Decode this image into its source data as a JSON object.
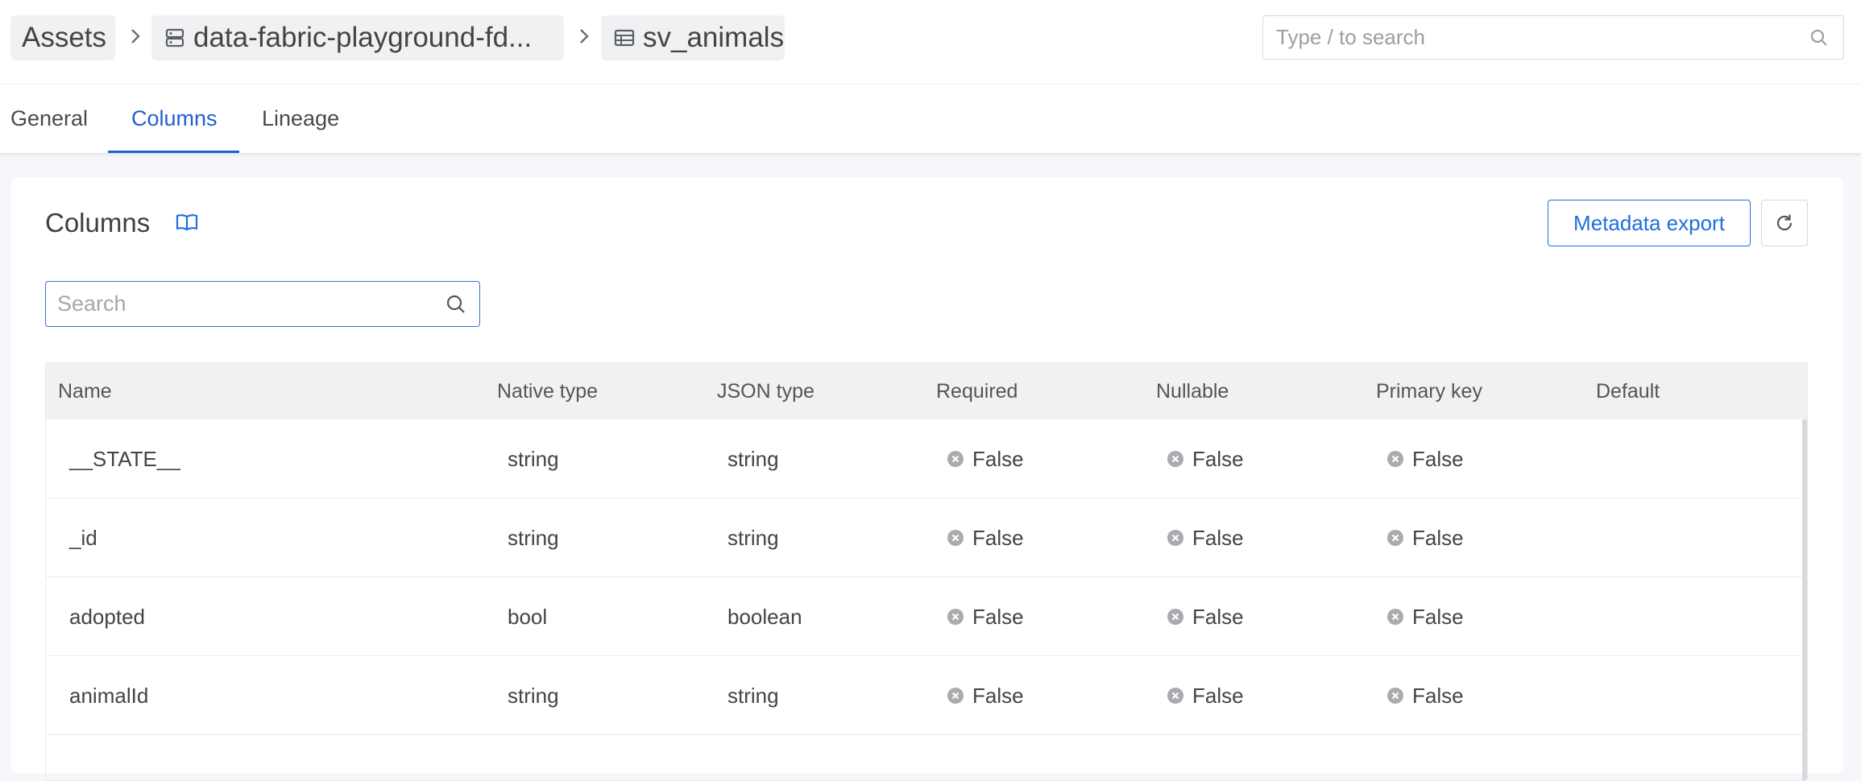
{
  "breadcrumb": {
    "items": [
      {
        "label": "Assets"
      },
      {
        "label": "data-fabric-playground-fd...",
        "icon": "database-icon"
      },
      {
        "label": "sv_animals",
        "icon": "table-icon"
      }
    ]
  },
  "search": {
    "placeholder": "Type / to search"
  },
  "tabs": [
    {
      "label": "General"
    },
    {
      "label": "Columns",
      "active": true
    },
    {
      "label": "Lineage"
    }
  ],
  "columns_panel": {
    "title": "Columns",
    "export_label": "Metadata export",
    "search_placeholder": "Search",
    "headers": [
      "Name",
      "Native type",
      "JSON type",
      "Required",
      "Nullable",
      "Primary key",
      "Default"
    ],
    "rows": [
      {
        "name": "__STATE__",
        "native": "string",
        "json": "string",
        "required": "False",
        "nullable": "False",
        "primary": "False",
        "default": ""
      },
      {
        "name": "_id",
        "native": "string",
        "json": "string",
        "required": "False",
        "nullable": "False",
        "primary": "False",
        "default": ""
      },
      {
        "name": "adopted",
        "native": "bool",
        "json": "boolean",
        "required": "False",
        "nullable": "False",
        "primary": "False",
        "default": ""
      },
      {
        "name": "animalId",
        "native": "string",
        "json": "string",
        "required": "False",
        "nullable": "False",
        "primary": "False",
        "default": ""
      }
    ]
  },
  "colors": {
    "accent": "#1f5fd6",
    "false_icon": "#a9abae"
  }
}
